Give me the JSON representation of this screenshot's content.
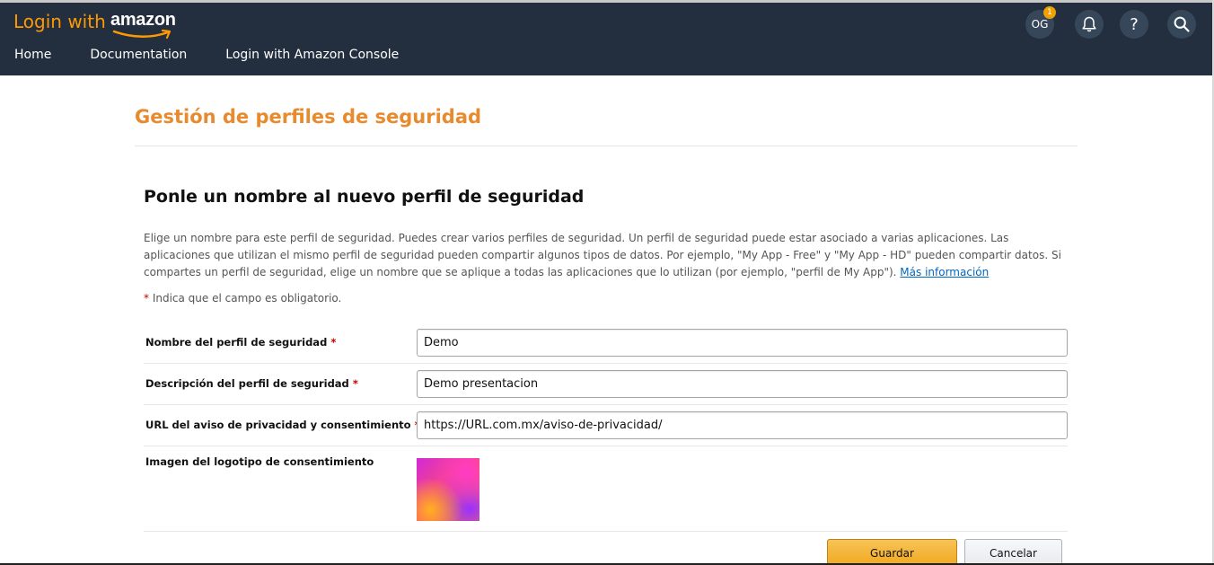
{
  "header": {
    "logo_prefix": "Login with",
    "logo_brand": "amazon",
    "avatar_initials": "OG",
    "notification_count": "1",
    "help_glyph": "?",
    "nav": [
      "Home",
      "Documentation",
      "Login with Amazon Console"
    ],
    "icons": [
      "bell-icon",
      "help-icon",
      "search-icon"
    ],
    "colors": {
      "bar": "#232f3e",
      "accent": "#ff9900"
    }
  },
  "page": {
    "title": "Gestión de perfiles de seguridad",
    "section_title": "Ponle un nombre al nuevo perfil de seguridad",
    "intro_text": "Elige un nombre para este perfil de seguridad. Puedes crear varios perfiles de seguridad. Un perfil de seguridad puede estar asociado a varias aplicaciones. Las aplicaciones que utilizan el mismo perfil de seguridad pueden compartir algunos tipos de datos. Por ejemplo, \"My App - Free\" y \"My App - HD\" pueden compartir datos. Si compartes un perfil de seguridad, elige un nombre que se aplique a todas las aplicaciones que lo utilizan (por ejemplo, \"perfil de My App\"). ",
    "more_info_link": "Más información",
    "required_star": "*",
    "required_note": " Indica que el campo es obligatorio."
  },
  "form": {
    "name": {
      "label": "Nombre del perfil de seguridad",
      "required": "*",
      "value": "Demo"
    },
    "description": {
      "label": "Descripción del perfil de seguridad",
      "required": "*",
      "value": "Demo presentacion"
    },
    "privacy_url": {
      "label": "URL del aviso de privacidad y consentimiento",
      "required": "*",
      "value": "https://URL.com.mx/aviso-de-privacidad/"
    },
    "logo": {
      "label": "Imagen del logotipo de consentimiento"
    }
  },
  "buttons": {
    "save": "Guardar",
    "cancel": "Cancelar"
  }
}
